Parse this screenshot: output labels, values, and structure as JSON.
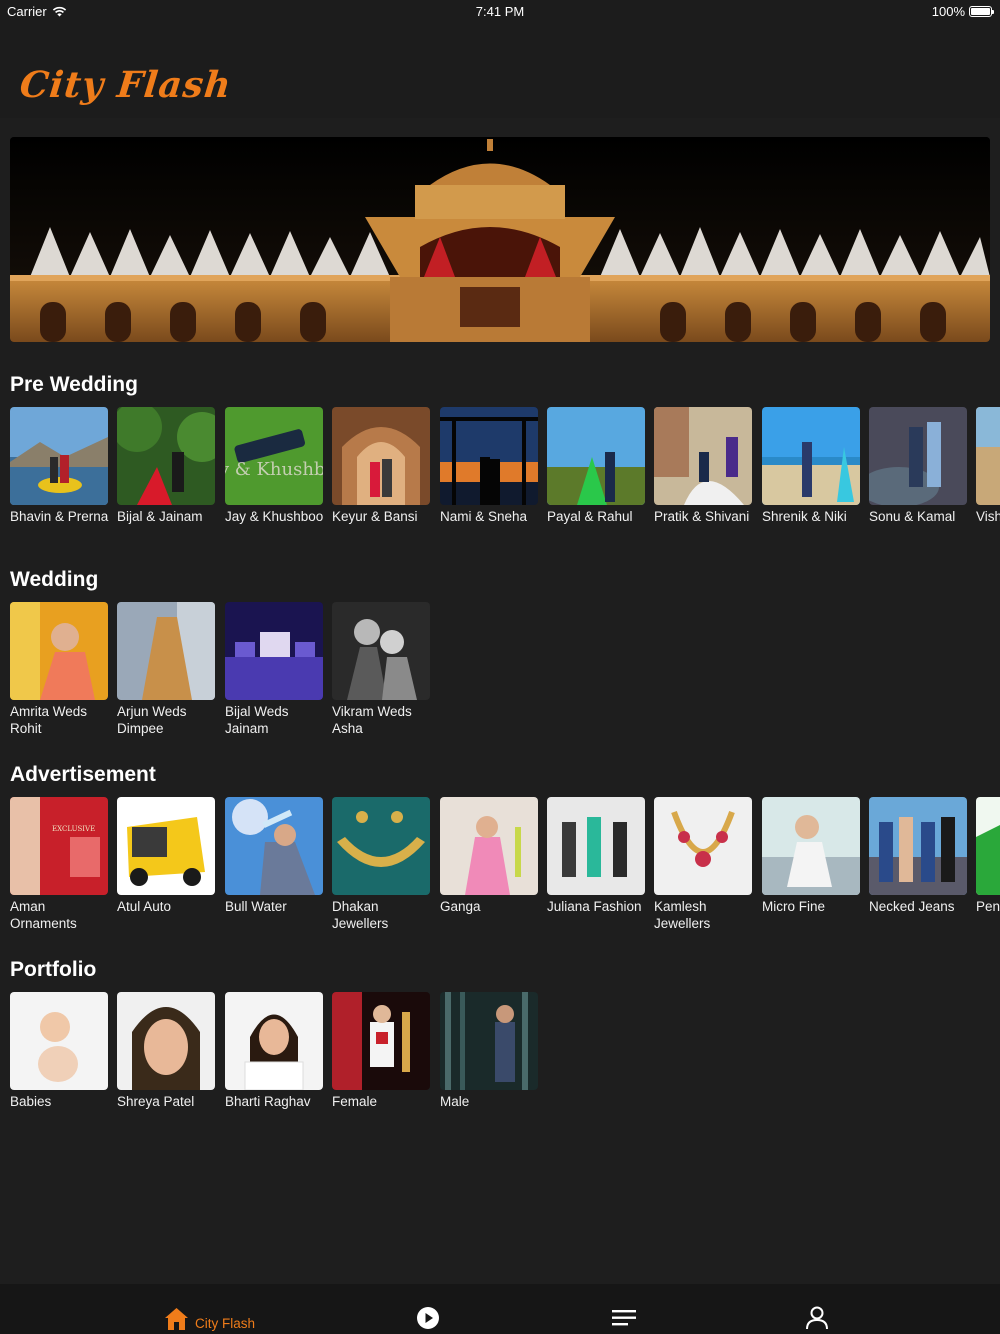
{
  "status_bar": {
    "carrier": "Carrier",
    "time": "7:41 PM",
    "battery": "100%"
  },
  "app": {
    "logo": "City Flash",
    "accent": "#ef7c1a"
  },
  "sections": {
    "pre_wedding": {
      "title": "Pre Wedding",
      "items": [
        "Bhavin & Prerna",
        "Bijal & Jainam",
        "Jay & Khushboo",
        "Keyur & Bansi",
        "Nami & Sneha",
        "Payal & Rahul",
        "Pratik & Shivani",
        "Shrenik & Niki",
        "Sonu & Kamal",
        "Vish"
      ]
    },
    "wedding": {
      "title": "Wedding",
      "items": [
        "Amrita Weds Rohit",
        "Arjun Weds Dimpee",
        "Bijal Weds Jainam",
        "Vikram Weds Asha"
      ]
    },
    "advertisement": {
      "title": "Advertisement",
      "items": [
        "Aman Ornaments",
        "Atul Auto",
        "Bull Water",
        "Dhakan Jewellers",
        "Ganga",
        "Juliana Fashion",
        "Kamlesh Jewellers",
        "Micro Fine",
        "Necked Jeans",
        "Pen Indu"
      ]
    },
    "portfolio": {
      "title": "Portfolio",
      "items": [
        "Babies",
        "Shreya Patel",
        "Bharti Raghav",
        "Female",
        "Male"
      ]
    }
  },
  "thumb_text": {
    "jay_khushboo": "Jay & Khushboo",
    "aman_exclusive": "EXCLUSIVE"
  },
  "tab_bar": {
    "home_label": "City Flash",
    "icons": [
      "home-icon",
      "play-icon",
      "menu-icon",
      "profile-icon"
    ]
  }
}
